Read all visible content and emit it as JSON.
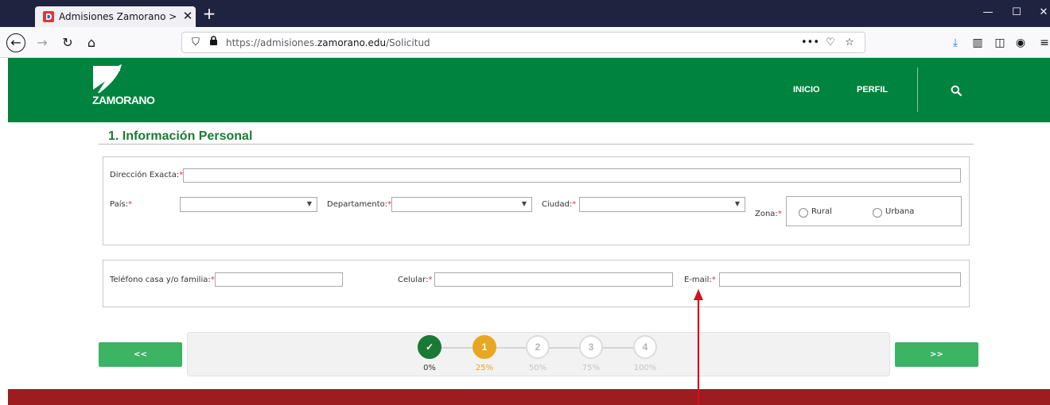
{
  "browser": {
    "tab_title": "Admisiones Zamorano > Solicit",
    "new_tab": "+",
    "close": "✕",
    "url_prefix": "https://admisiones.",
    "url_host": "zamorano.edu",
    "url_path": "/Solicitud",
    "page_actions": "•••"
  },
  "site": {
    "logo_text": "ZAMORANO",
    "menu": [
      "INICIO",
      "PERFIL"
    ]
  },
  "form": {
    "section_title": "1. Información Personal",
    "fields": {
      "direccion": "Dirección Exacta:",
      "pais": "País:",
      "departamento": "Departamento:",
      "ciudad": "Ciudad:",
      "zona": "Zona:",
      "telefono": "Teléfono casa y/o familia:",
      "celular": "Celular:",
      "email": "E-mail:"
    },
    "required_mark": "*",
    "zona_options": [
      "Rural",
      "Urbana"
    ]
  },
  "stepper": {
    "prev": "<<",
    "next": ">>",
    "steps": [
      {
        "label": "✓",
        "pct": "0%"
      },
      {
        "label": "1",
        "pct": "25%"
      },
      {
        "label": "2",
        "pct": "50%"
      },
      {
        "label": "3",
        "pct": "75%"
      },
      {
        "label": "4",
        "pct": "100%"
      }
    ]
  },
  "colors": {
    "header_green": "#00833e",
    "title_green": "#1a7a35",
    "button_green": "#3cb463",
    "done_step": "#1a7a35",
    "active_step": "#e8a723",
    "footer_red": "#9c1c1f",
    "arrow_red": "#d6101d"
  }
}
